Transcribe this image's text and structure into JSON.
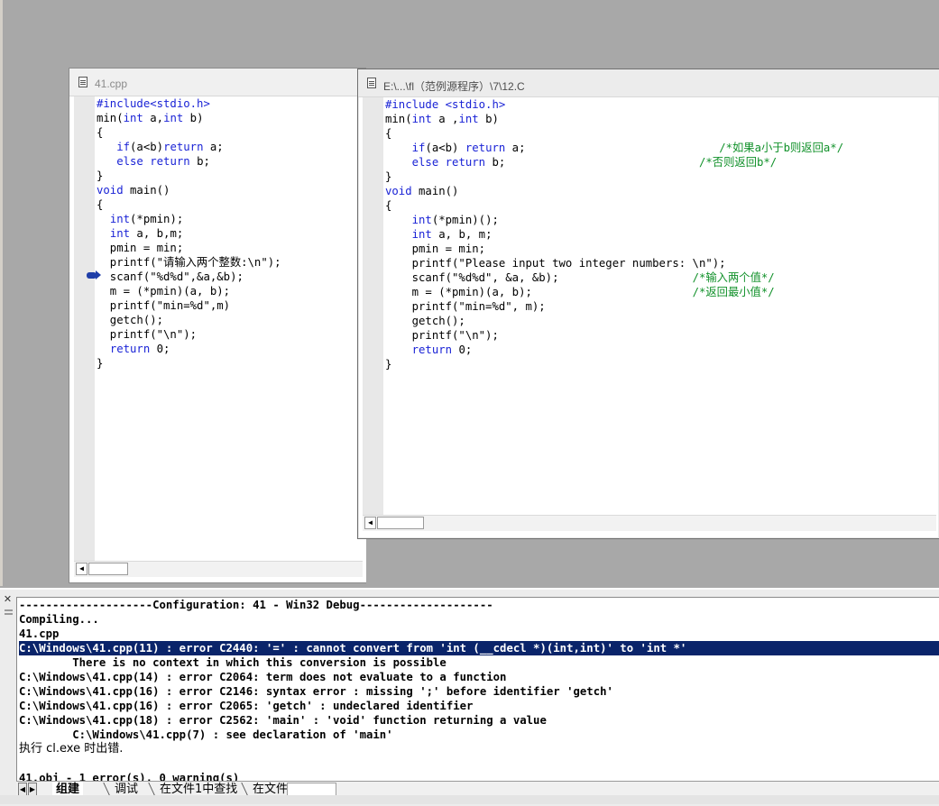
{
  "window_a": {
    "title": "41.cpp",
    "code_lines": [
      {
        "text": "#include<stdio.h>",
        "type": "kw"
      },
      {
        "text": "min(",
        "type": "normal",
        "rest": [
          {
            "t": "int",
            "k": 1
          },
          {
            "t": " a,",
            "k": 0
          },
          {
            "t": "int",
            "k": 1
          },
          {
            "t": " b)",
            "k": 0
          }
        ]
      },
      {
        "text": "{",
        "type": "normal"
      },
      {
        "text": "   ",
        "type": "normal",
        "rest": [
          {
            "t": "if",
            "k": 1
          },
          {
            "t": "(a<b)",
            "k": 0
          },
          {
            "t": "return",
            "k": 1
          },
          {
            "t": " a;",
            "k": 0
          }
        ]
      },
      {
        "text": "   ",
        "type": "normal",
        "rest": [
          {
            "t": "else",
            "k": 1
          },
          {
            "t": " ",
            "k": 0
          },
          {
            "t": "return",
            "k": 1
          },
          {
            "t": " b;",
            "k": 0
          }
        ]
      },
      {
        "text": "}",
        "type": "normal"
      },
      {
        "text": "",
        "type": "normal",
        "rest": [
          {
            "t": "void",
            "k": 1
          },
          {
            "t": " main()",
            "k": 0
          }
        ]
      },
      {
        "text": "{",
        "type": "normal"
      },
      {
        "text": "  ",
        "type": "normal",
        "rest": [
          {
            "t": "int",
            "k": 1
          },
          {
            "t": "(*pmin);",
            "k": 0
          }
        ]
      },
      {
        "text": "  ",
        "type": "normal",
        "rest": [
          {
            "t": "int",
            "k": 1
          },
          {
            "t": " a, b,m;",
            "k": 0
          }
        ]
      },
      {
        "text": "  pmin = min;",
        "type": "normal"
      },
      {
        "text": "  printf(\"请输入两个整数:\\n\");",
        "type": "normal"
      },
      {
        "text": "  scanf(\"%d%d\",&a,&b);",
        "type": "normal"
      },
      {
        "text": "  m = (*pmin)(a, b);",
        "type": "normal"
      },
      {
        "text": "  printf(\"min=%d\",m)",
        "type": "normal"
      },
      {
        "text": "  getch();",
        "type": "normal"
      },
      {
        "text": "  printf(\"\\n\");",
        "type": "normal"
      },
      {
        "text": "  ",
        "type": "normal",
        "rest": [
          {
            "t": "return",
            "k": 1
          },
          {
            "t": " 0;",
            "k": 0
          }
        ]
      },
      {
        "text": "}",
        "type": "normal"
      }
    ]
  },
  "window_b": {
    "title": "E:\\...\\fl（范例源程序）\\7\\12.C",
    "code_lines": [
      {
        "text": "#include <stdio.h>",
        "type": "kw"
      },
      {
        "text": "min(",
        "type": "normal",
        "rest": [
          {
            "t": "int",
            "k": 1
          },
          {
            "t": " a ,",
            "k": 0
          },
          {
            "t": "int",
            "k": 1
          },
          {
            "t": " b)",
            "k": 0
          }
        ]
      },
      {
        "text": "{",
        "type": "normal"
      },
      {
        "text": "    ",
        "type": "normal",
        "rest": [
          {
            "t": "if",
            "k": 1
          },
          {
            "t": "(a<b) ",
            "k": 0
          },
          {
            "t": "return",
            "k": 1
          },
          {
            "t": " a;                             ",
            "k": 0
          },
          {
            "t": "/*如果a小于b则返回a*/",
            "k": 2
          }
        ]
      },
      {
        "text": "    ",
        "type": "normal",
        "rest": [
          {
            "t": "else",
            "k": 1
          },
          {
            "t": " ",
            "k": 0
          },
          {
            "t": "return",
            "k": 1
          },
          {
            "t": " b;                             ",
            "k": 0
          },
          {
            "t": "/*否则返回b*/",
            "k": 2
          }
        ]
      },
      {
        "text": "}",
        "type": "normal"
      },
      {
        "text": "",
        "type": "normal",
        "rest": [
          {
            "t": "void",
            "k": 1
          },
          {
            "t": " main()",
            "k": 0
          }
        ]
      },
      {
        "text": "{",
        "type": "normal"
      },
      {
        "text": "    ",
        "type": "normal",
        "rest": [
          {
            "t": "int",
            "k": 1
          },
          {
            "t": "(*pmin)();",
            "k": 0
          }
        ]
      },
      {
        "text": "    ",
        "type": "normal",
        "rest": [
          {
            "t": "int",
            "k": 1
          },
          {
            "t": " a, b, m;",
            "k": 0
          }
        ]
      },
      {
        "text": "    pmin = min;",
        "type": "normal"
      },
      {
        "text": "    printf(\"Please input two integer numbers: \\n\");",
        "type": "normal"
      },
      {
        "text": "    scanf(\"%d%d\", &a, &b);",
        "type": "normal",
        "rest": [
          {
            "t": "                    ",
            "k": 0
          },
          {
            "t": "/*输入两个值*/",
            "k": 2
          }
        ]
      },
      {
        "text": "    m = (*pmin)(a, b);",
        "type": "normal",
        "rest": [
          {
            "t": "                        ",
            "k": 0
          },
          {
            "t": "/*返回最小值*/",
            "k": 2
          }
        ]
      },
      {
        "text": "    printf(\"min=%d\", m);",
        "type": "normal"
      },
      {
        "text": "    getch();",
        "type": "normal"
      },
      {
        "text": "    printf(\"\\n\");",
        "type": "normal"
      },
      {
        "text": "    ",
        "type": "normal",
        "rest": [
          {
            "t": "return",
            "k": 1
          },
          {
            "t": " 0;",
            "k": 0
          }
        ]
      },
      {
        "text": "}",
        "type": "normal"
      }
    ]
  },
  "output": {
    "lines": [
      {
        "text": "--------------------Configuration: 41 - Win32 Debug--------------------",
        "selected": false
      },
      {
        "text": "Compiling...",
        "selected": false
      },
      {
        "text": "41.cpp",
        "selected": false
      },
      {
        "text": "C:\\Windows\\41.cpp(11) : error C2440: '=' : cannot convert from 'int (__cdecl *)(int,int)' to 'int *'",
        "selected": true
      },
      {
        "text": "        There is no context in which this conversion is possible",
        "selected": false
      },
      {
        "text": "C:\\Windows\\41.cpp(14) : error C2064: term does not evaluate to a function",
        "selected": false
      },
      {
        "text": "C:\\Windows\\41.cpp(16) : error C2146: syntax error : missing ';' before identifier 'getch'",
        "selected": false
      },
      {
        "text": "C:\\Windows\\41.cpp(16) : error C2065: 'getch' : undeclared identifier",
        "selected": false
      },
      {
        "text": "C:\\Windows\\41.cpp(18) : error C2562: 'main' : 'void' function returning a value",
        "selected": false
      },
      {
        "text": "        C:\\Windows\\41.cpp(7) : see declaration of 'main'",
        "selected": false
      },
      {
        "text": "执行 cl.exe 时出错.",
        "selected": false,
        "cn": true
      },
      {
        "text": "",
        "selected": false
      },
      {
        "text": "41.obj - 1 error(s), 0 warning(s)",
        "selected": false
      }
    ],
    "tabs": [
      "组建",
      "调试",
      "在文件1中查找",
      "在文件"
    ],
    "active_tab": 0
  },
  "icons": [
    "document-icon",
    "breakpoint-arrow-icon",
    "close-icon",
    "scroll-left-icon"
  ]
}
